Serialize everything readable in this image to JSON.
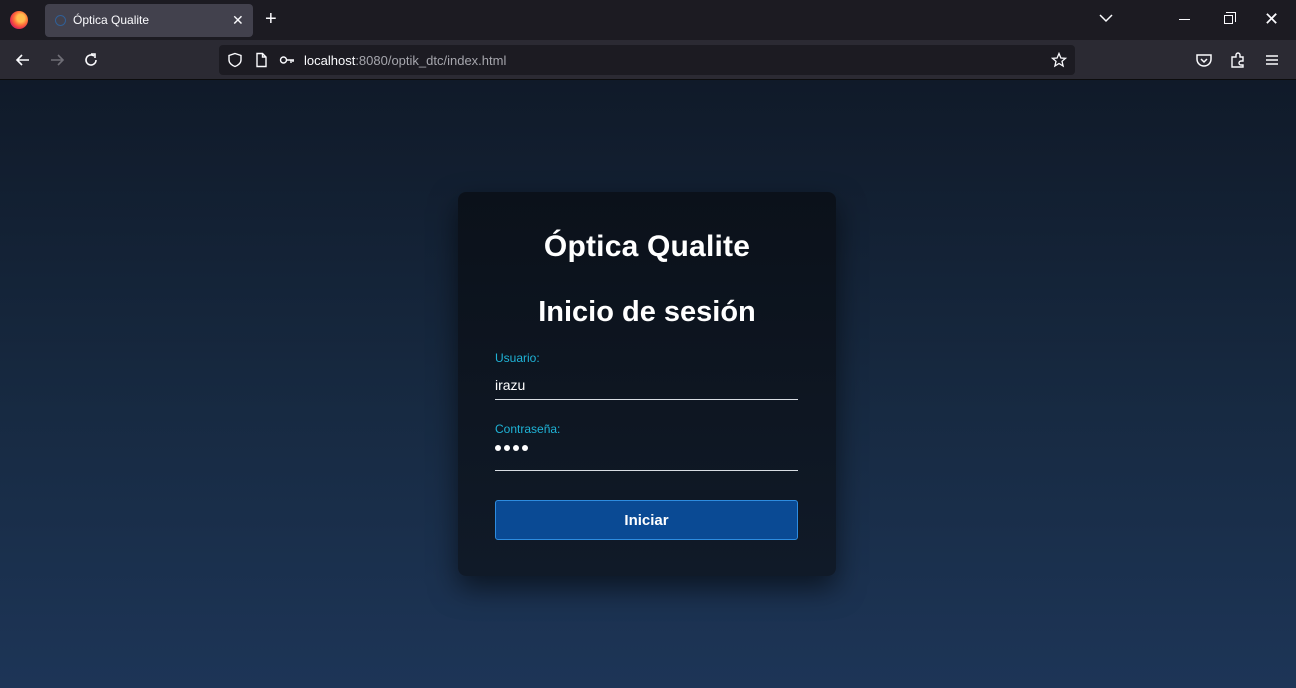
{
  "browser": {
    "tab_title": "Óptica Qualite",
    "tab_close": "✕",
    "new_tab": "+",
    "window_close": "✕",
    "url_host": "localhost",
    "url_rest": ":8080/optik_dtc/index.html",
    "icons": {
      "back": "arrow-left-icon",
      "forward": "arrow-right-icon",
      "reload": "reload-icon",
      "shield": "shield-icon",
      "page": "page-icon",
      "key": "key-icon",
      "bookmark": "star-icon",
      "pocket": "pocket-icon",
      "extensions": "puzzle-icon",
      "menu": "hamburger-menu-icon"
    }
  },
  "login": {
    "brand": "Óptica Qualite",
    "heading": "Inicio de sesión",
    "user_label": "Usuario:",
    "user_value": "irazu",
    "password_label": "Contraseña:",
    "password_masked_length": 4,
    "submit_label": "Iniciar"
  },
  "colors": {
    "accent_label": "#1fb3d6",
    "button_bg": "#0a4a94",
    "button_border": "#2d8ce0",
    "card_bg": "#0b111a",
    "page_bg_top": "#101a29",
    "page_bg_bottom": "#1d3557"
  }
}
